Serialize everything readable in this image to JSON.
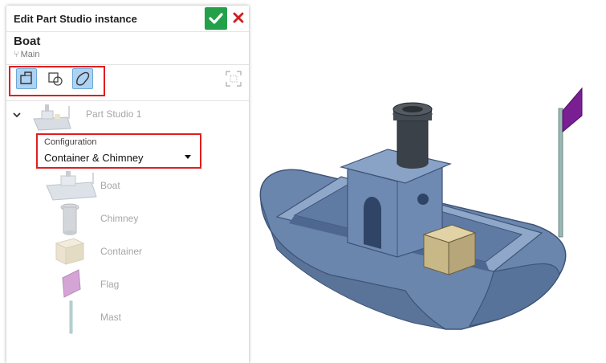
{
  "header": {
    "title": "Edit Part Studio instance"
  },
  "document": {
    "name": "Boat",
    "branch": "Main"
  },
  "tree": {
    "studio_label": "Part Studio 1",
    "configuration": {
      "label": "Configuration",
      "value": "Container & Chimney"
    },
    "parts": [
      {
        "label": "Boat"
      },
      {
        "label": "Chimney"
      },
      {
        "label": "Container"
      },
      {
        "label": "Flag"
      },
      {
        "label": "Mast"
      }
    ]
  },
  "colors": {
    "accept": "#23a14a",
    "cancel": "#cc1f1f",
    "highlight": "#e01e1e",
    "active_tool": "#aed3f2"
  },
  "icons": [
    "check-icon",
    "close-icon",
    "branch-icon",
    "part-select-icon",
    "surface-select-icon",
    "sketch-select-icon",
    "fit-view-icon",
    "chevron-down-icon"
  ]
}
